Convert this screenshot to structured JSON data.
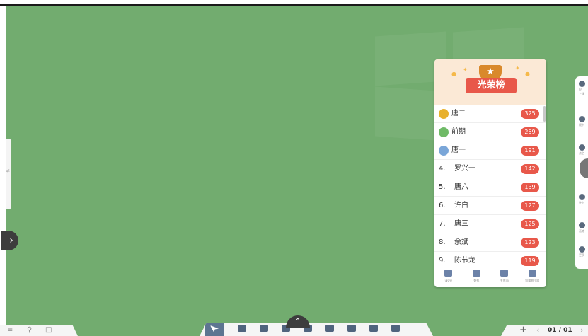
{
  "leaderboard": {
    "title": "光荣榜",
    "rows": [
      {
        "rank": "",
        "medal": "gold",
        "name": "唐二",
        "score": "325"
      },
      {
        "rank": "",
        "medal": "green",
        "name": "前期",
        "score": "259"
      },
      {
        "rank": "",
        "medal": "blue",
        "name": "唐一",
        "score": "191"
      },
      {
        "rank": "4.",
        "medal": "",
        "name": "罗兴一",
        "score": "142"
      },
      {
        "rank": "5.",
        "medal": "",
        "name": "唐六",
        "score": "139"
      },
      {
        "rank": "6.",
        "medal": "",
        "name": "许白",
        "score": "127"
      },
      {
        "rank": "7.",
        "medal": "",
        "name": "唐三",
        "score": "125"
      },
      {
        "rank": "8.",
        "medal": "",
        "name": "余斌",
        "score": "123"
      },
      {
        "rank": "9.",
        "medal": "",
        "name": "陈节龙",
        "score": "119"
      }
    ],
    "footer": [
      {
        "label": "清0分",
        "icon": "reset-icon"
      },
      {
        "label": "查找",
        "icon": "search-icon"
      },
      {
        "label": "主界面",
        "icon": "trophy-icon"
      },
      {
        "label": "切换到小组",
        "icon": "group-icon"
      }
    ]
  },
  "right_toolbar": {
    "count_text": "0/",
    "top_label": "上课",
    "items": [
      {
        "label": "板书",
        "icon": "camera-icon"
      },
      {
        "label": "点名",
        "icon": "person-icon"
      },
      {
        "label": "抢答",
        "icon": "avatar-icon"
      },
      {
        "label": "计时",
        "icon": "cloud-icon"
      },
      {
        "label": "画笔",
        "icon": "brush-icon"
      },
      {
        "label": "更多",
        "icon": "arrow-icon"
      }
    ]
  },
  "left_tab": {
    "label": "⇄"
  },
  "left_arrow": {
    "glyph": "›"
  },
  "bottom_left": {
    "icons": [
      "≡",
      "⚲",
      "□"
    ]
  },
  "bottom_center": {
    "collapse_glyph": "⌃",
    "tools": [
      {
        "name": "select",
        "active": true
      },
      {
        "name": "pen",
        "active": false
      },
      {
        "name": "highlighter",
        "active": false
      },
      {
        "name": "eraser",
        "active": false
      },
      {
        "name": "magic",
        "active": false
      },
      {
        "name": "resource",
        "active": false
      },
      {
        "name": "download",
        "active": false
      },
      {
        "name": "annotate",
        "active": false
      },
      {
        "name": "screen",
        "active": false
      }
    ]
  },
  "bottom_right": {
    "add": "+",
    "prev": "‹",
    "page": "01 / 01",
    "next": "›"
  },
  "colors": {
    "board": "#72ac6f",
    "score_badge": "#e8584a",
    "banner": "#e8584a",
    "toolbar_active": "#5d7591"
  }
}
